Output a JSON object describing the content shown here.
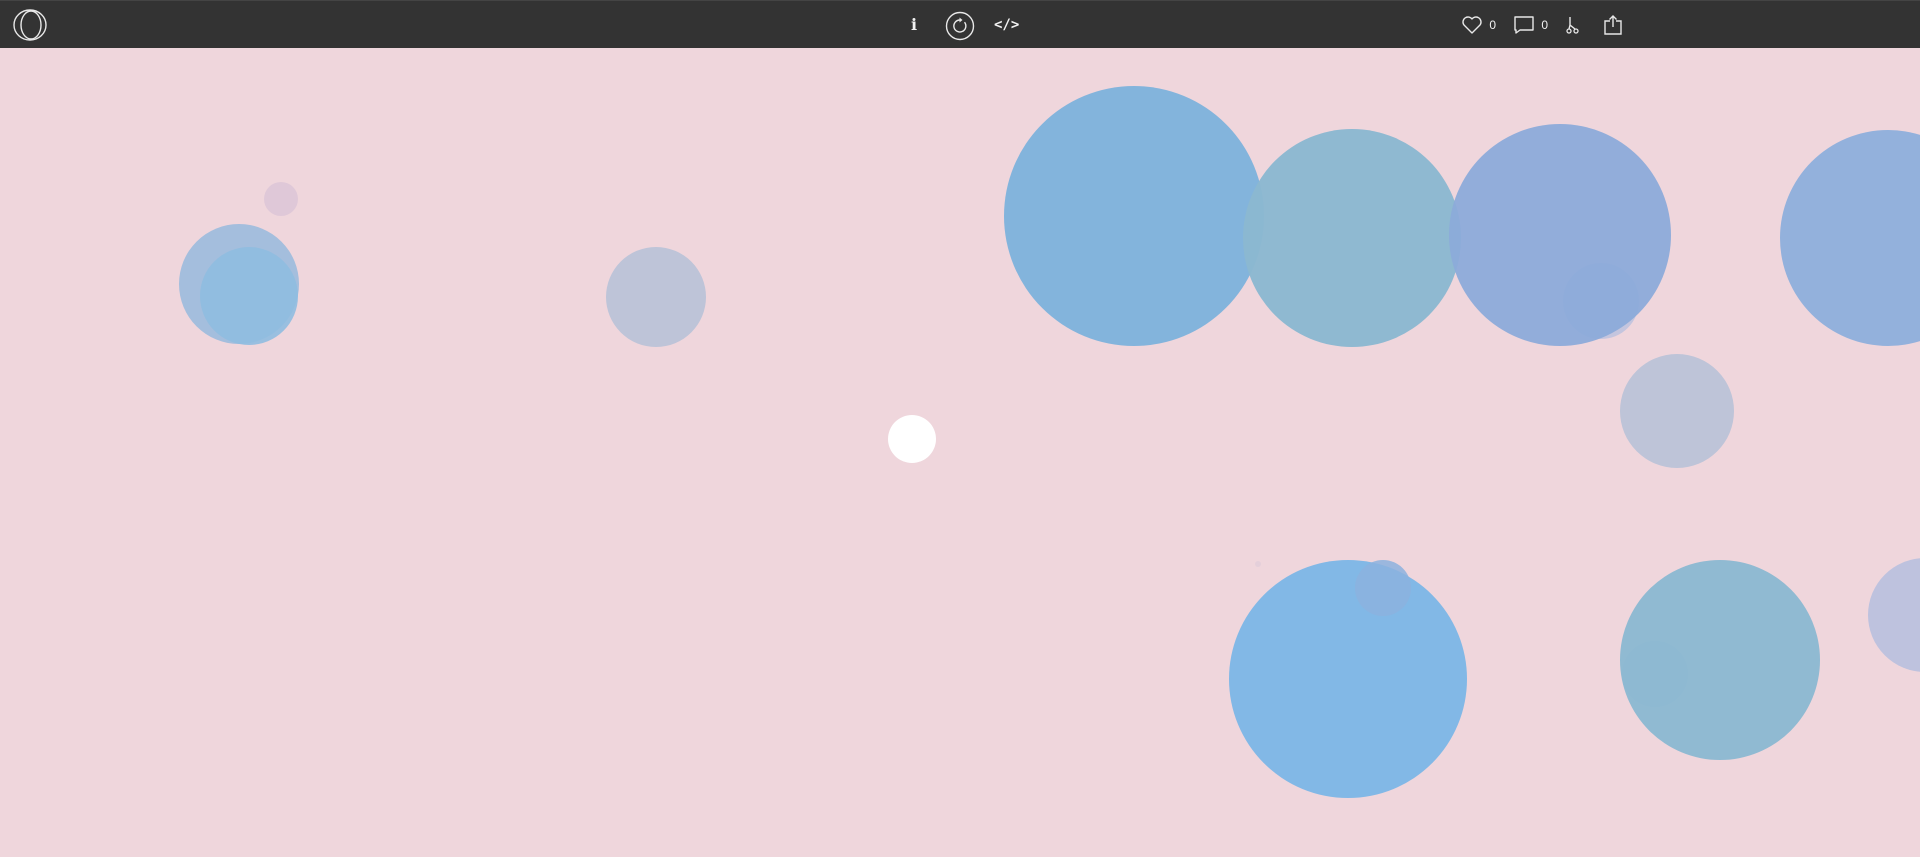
{
  "toolbar": {
    "logo_icon": "openprocessing-logo-icon",
    "info_label": "i",
    "reload_icon": "reload-icon",
    "code_label": "</>",
    "like_icon": "heart-icon",
    "like_count": "0",
    "comment_icon": "comment-icon",
    "comment_count": "0",
    "fork_icon": "fork-icon",
    "share_icon": "share-icon"
  },
  "sketch": {
    "background_color": "#EFD6DC",
    "pointer_color": "#FFFFFF",
    "palette": [
      "#7FB3DC",
      "#8BB8D1",
      "#8CABD9",
      "#8FA8DA",
      "#BEC4D8",
      "#B9C1DE",
      "#82B8E6",
      "#DFC8D8"
    ]
  }
}
